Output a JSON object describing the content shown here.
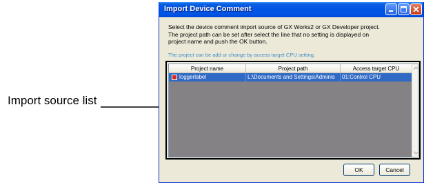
{
  "callout": {
    "label": "Import source list"
  },
  "window": {
    "title": "Import Device Comment",
    "controls": [
      "minimize-icon",
      "maximize-icon",
      "close-icon"
    ]
  },
  "description": "Select the device comment import source of GX Works2 or GX Developer project.\nThe project path can be set after select the line that no setting is displayed on\nproject name and push the OK button.",
  "hint": "The project can be add or change by access target CPU setting.",
  "list": {
    "columns": [
      "Project name",
      "Project path",
      "Access target CPU"
    ],
    "rows": [
      {
        "icon": "project-icon",
        "name": "loggerlabel",
        "path": "L:\\Documents and Settings\\Adminis",
        "cpu": "01:Control CPU",
        "selected": true
      }
    ]
  },
  "buttons": {
    "ok": "OK",
    "cancel": "Cancel"
  },
  "colors": {
    "titlebar": "#0055e5",
    "selection": "#316ac5",
    "hint": "#3b8ec9",
    "list_bg": "#848284"
  }
}
